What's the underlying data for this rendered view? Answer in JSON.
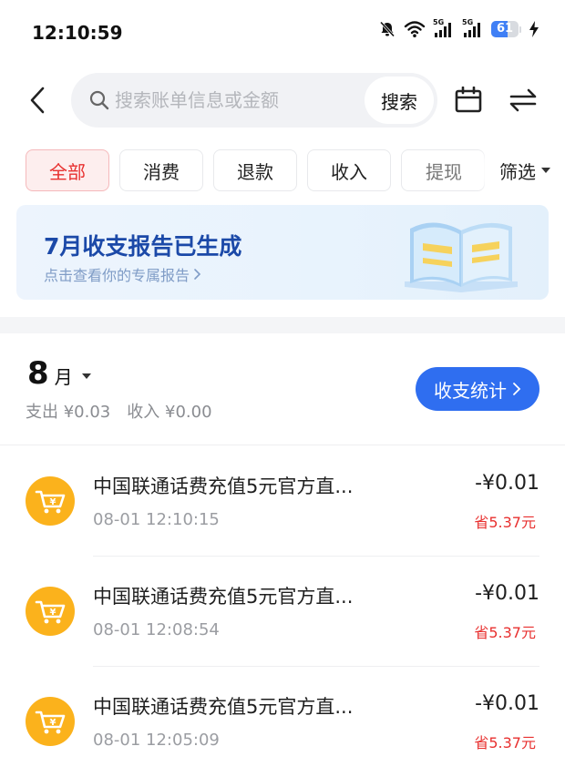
{
  "status_bar": {
    "time": "12:10:59",
    "net1": "5G",
    "net2": "5G",
    "battery": "61",
    "battery_level": 0.61
  },
  "search": {
    "placeholder": "搜索账单信息或金额",
    "button_label": "搜索"
  },
  "tabs": [
    {
      "label": "全部",
      "active": true
    },
    {
      "label": "消费",
      "active": false
    },
    {
      "label": "退款",
      "active": false
    },
    {
      "label": "收入",
      "active": false
    },
    {
      "label": "提现",
      "active": false
    }
  ],
  "filter_label": "筛选",
  "report": {
    "title": "7月收支报告已生成",
    "subtitle": "点击查看你的专属报告"
  },
  "month": {
    "number": "8",
    "unit": "月",
    "expense": "支出 ¥0.03",
    "income": "收入 ¥0.00",
    "stats_button": "收支统计"
  },
  "transactions": [
    {
      "title": "中国联通话费充值5元官方直...",
      "time": "08-01 12:10:15",
      "amount": "-¥0.01",
      "saving": "省5.37元"
    },
    {
      "title": "中国联通话费充值5元官方直...",
      "time": "08-01 12:08:54",
      "amount": "-¥0.01",
      "saving": "省5.37元"
    },
    {
      "title": "中国联通话费充值5元官方直...",
      "time": "08-01 12:05:09",
      "amount": "-¥0.01",
      "saving": "省5.37元"
    }
  ],
  "colors": {
    "accent_blue": "#2f6ef0",
    "accent_red": "#e8302f",
    "icon_orange": "#fbb21c"
  },
  "icons": {
    "back": "chevron-left-icon",
    "search": "search-icon",
    "calendar": "calendar-icon",
    "switch": "swap-arrows-icon",
    "transaction": "shopping-cart-icon"
  }
}
